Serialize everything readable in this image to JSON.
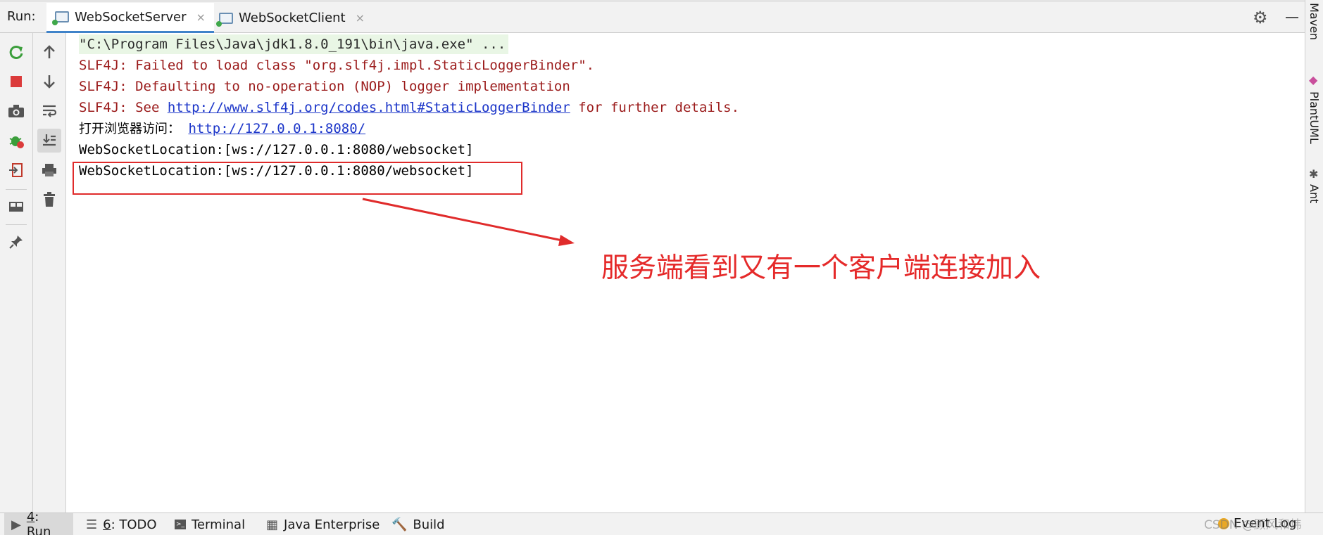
{
  "header": {
    "run_label": "Run:",
    "tabs": [
      {
        "label": "WebSocketServer",
        "active": true
      },
      {
        "label": "WebSocketClient",
        "active": false
      }
    ],
    "close_glyph": "×",
    "gear_icon": "gear-icon",
    "minimize_icon": "minimize-icon"
  },
  "toolbar": {
    "column1": [
      "rerun-icon",
      "stop-icon",
      "camera-icon",
      "debug-icon",
      "import-icon",
      "layout-icon",
      "pin-icon"
    ],
    "column2": [
      "arrow-up-icon",
      "arrow-down-icon",
      "soft-wrap-icon",
      "scroll-to-end-icon",
      "print-icon",
      "trash-icon"
    ]
  },
  "console": {
    "cmd_line": "\"C:\\Program Files\\Java\\jdk1.8.0_191\\bin\\java.exe\" ...",
    "err1": "SLF4J: Failed to load class \"org.slf4j.impl.StaticLoggerBinder\".",
    "err2": "SLF4J: Defaulting to no-operation (NOP) logger implementation",
    "err3_prefix": "SLF4J: See ",
    "err3_link": "http://www.slf4j.org/codes.html#StaticLoggerBinder",
    "err3_suffix": " for further details.",
    "browse_prefix": "打开浏览器访问：",
    "browse_link": "http://127.0.0.1:8080/",
    "ws_line1": "WebSocketLocation:[ws://127.0.0.1:8080/websocket]",
    "ws_line2": "WebSocketLocation:[ws://127.0.0.1:8080/websocket]"
  },
  "annotation": {
    "text": "服务端看到又有一个客户端连接加入",
    "color": "#e52a2a"
  },
  "right_strip": {
    "tabs": [
      "Maven",
      "PlantUML",
      "Ant"
    ]
  },
  "bottom_bar": {
    "tabs": [
      {
        "num": "4",
        "label": ": Run",
        "active": true,
        "icon": "run-icon"
      },
      {
        "num": "6",
        "label": ": TODO",
        "active": false,
        "icon": "todo-icon"
      },
      {
        "num": "",
        "label": "Terminal",
        "active": false,
        "icon": "terminal-icon"
      },
      {
        "num": "",
        "label": "Java Enterprise",
        "active": false,
        "icon": "java-enterprise-icon"
      },
      {
        "num": "",
        "label": "Build",
        "active": false,
        "icon": "build-icon"
      }
    ],
    "event_log": "Event Log",
    "watermark": "CSDN @顾风和炜"
  }
}
